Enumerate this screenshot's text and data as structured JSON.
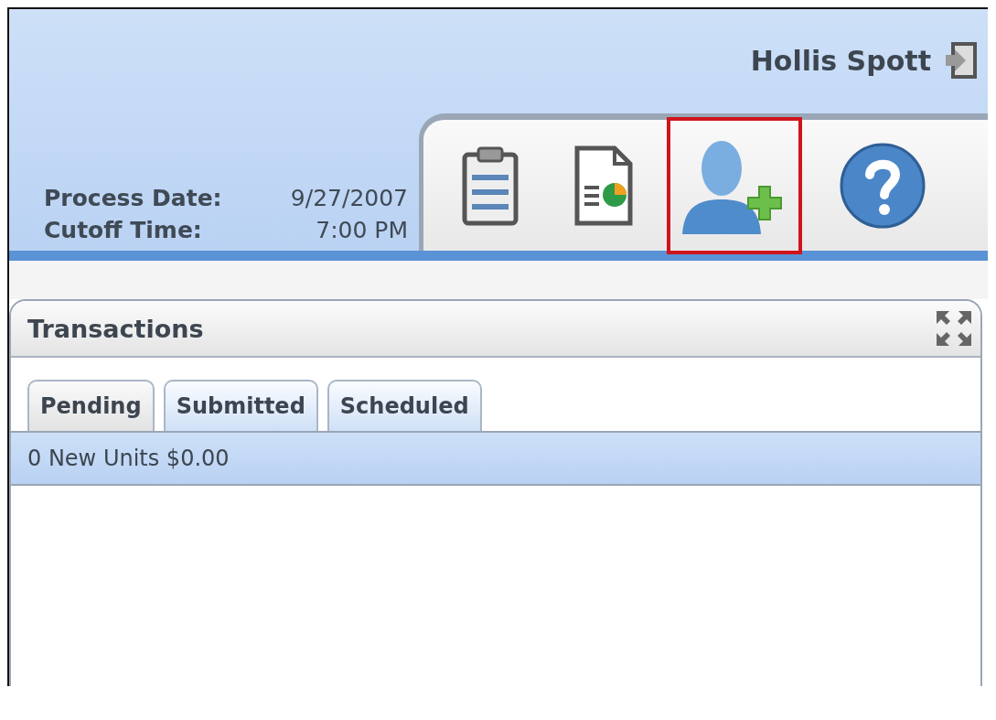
{
  "user": {
    "name": "Hollis Spott"
  },
  "process_date": {
    "label": "Process Date:",
    "value": "9/27/2007"
  },
  "cutoff_time": {
    "label": "Cutoff Time:",
    "value": "7:00 PM"
  },
  "toolbar": [
    {
      "kind": "clipboard",
      "highlighted": false
    },
    {
      "kind": "report",
      "highlighted": false
    },
    {
      "kind": "add-user",
      "highlighted": true
    },
    {
      "kind": "help",
      "highlighted": false
    }
  ],
  "panel": {
    "title": "Transactions",
    "tabs": [
      {
        "label": "Pending",
        "selected": true
      },
      {
        "label": "Submitted",
        "selected": false
      },
      {
        "label": "Scheduled",
        "selected": false
      }
    ],
    "summary": "0 New Units $0.00"
  }
}
